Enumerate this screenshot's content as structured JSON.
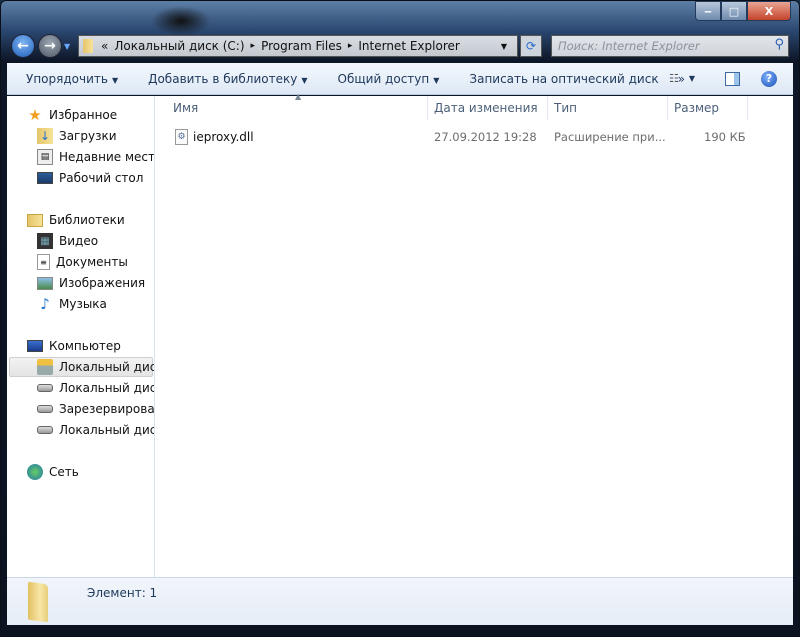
{
  "window": {
    "buttons": {
      "minimize": "‒",
      "maximize": "□",
      "close": "X"
    }
  },
  "address": {
    "overflow": "«",
    "crumbs": [
      "Локальный диск (C:)",
      "Program Files",
      "Internet Explorer"
    ],
    "separator": "▸"
  },
  "search": {
    "placeholder": "Поиск: Internet Explorer"
  },
  "toolbar": {
    "organize": "Упорядочить",
    "add_library": "Добавить в библиотеку",
    "share": "Общий доступ",
    "burn": "Записать на оптический диск",
    "more": "»",
    "help": "?"
  },
  "sidebar": {
    "favorites": {
      "label": "Избранное",
      "items": [
        "Загрузки",
        "Недавние места",
        "Рабочий стол"
      ]
    },
    "libraries": {
      "label": "Библиотеки",
      "items": [
        "Видео",
        "Документы",
        "Изображения",
        "Музыка"
      ]
    },
    "computer": {
      "label": "Компьютер",
      "items": [
        "Локальный диск",
        "Локальный диск",
        "Зарезервировано",
        "Локальный диск"
      ]
    },
    "network": {
      "label": "Сеть"
    }
  },
  "columns": {
    "name": "Имя",
    "date": "Дата изменения",
    "type": "Тип",
    "size": "Размер"
  },
  "files": [
    {
      "name": "ieproxy.dll",
      "date": "27.09.2012 19:28",
      "type": "Расширение при...",
      "size": "190 КБ"
    }
  ],
  "status": {
    "count": "Элемент: 1"
  },
  "colors": {
    "toolbar_text": "#1e395b",
    "frame": "#1b2f4c"
  }
}
